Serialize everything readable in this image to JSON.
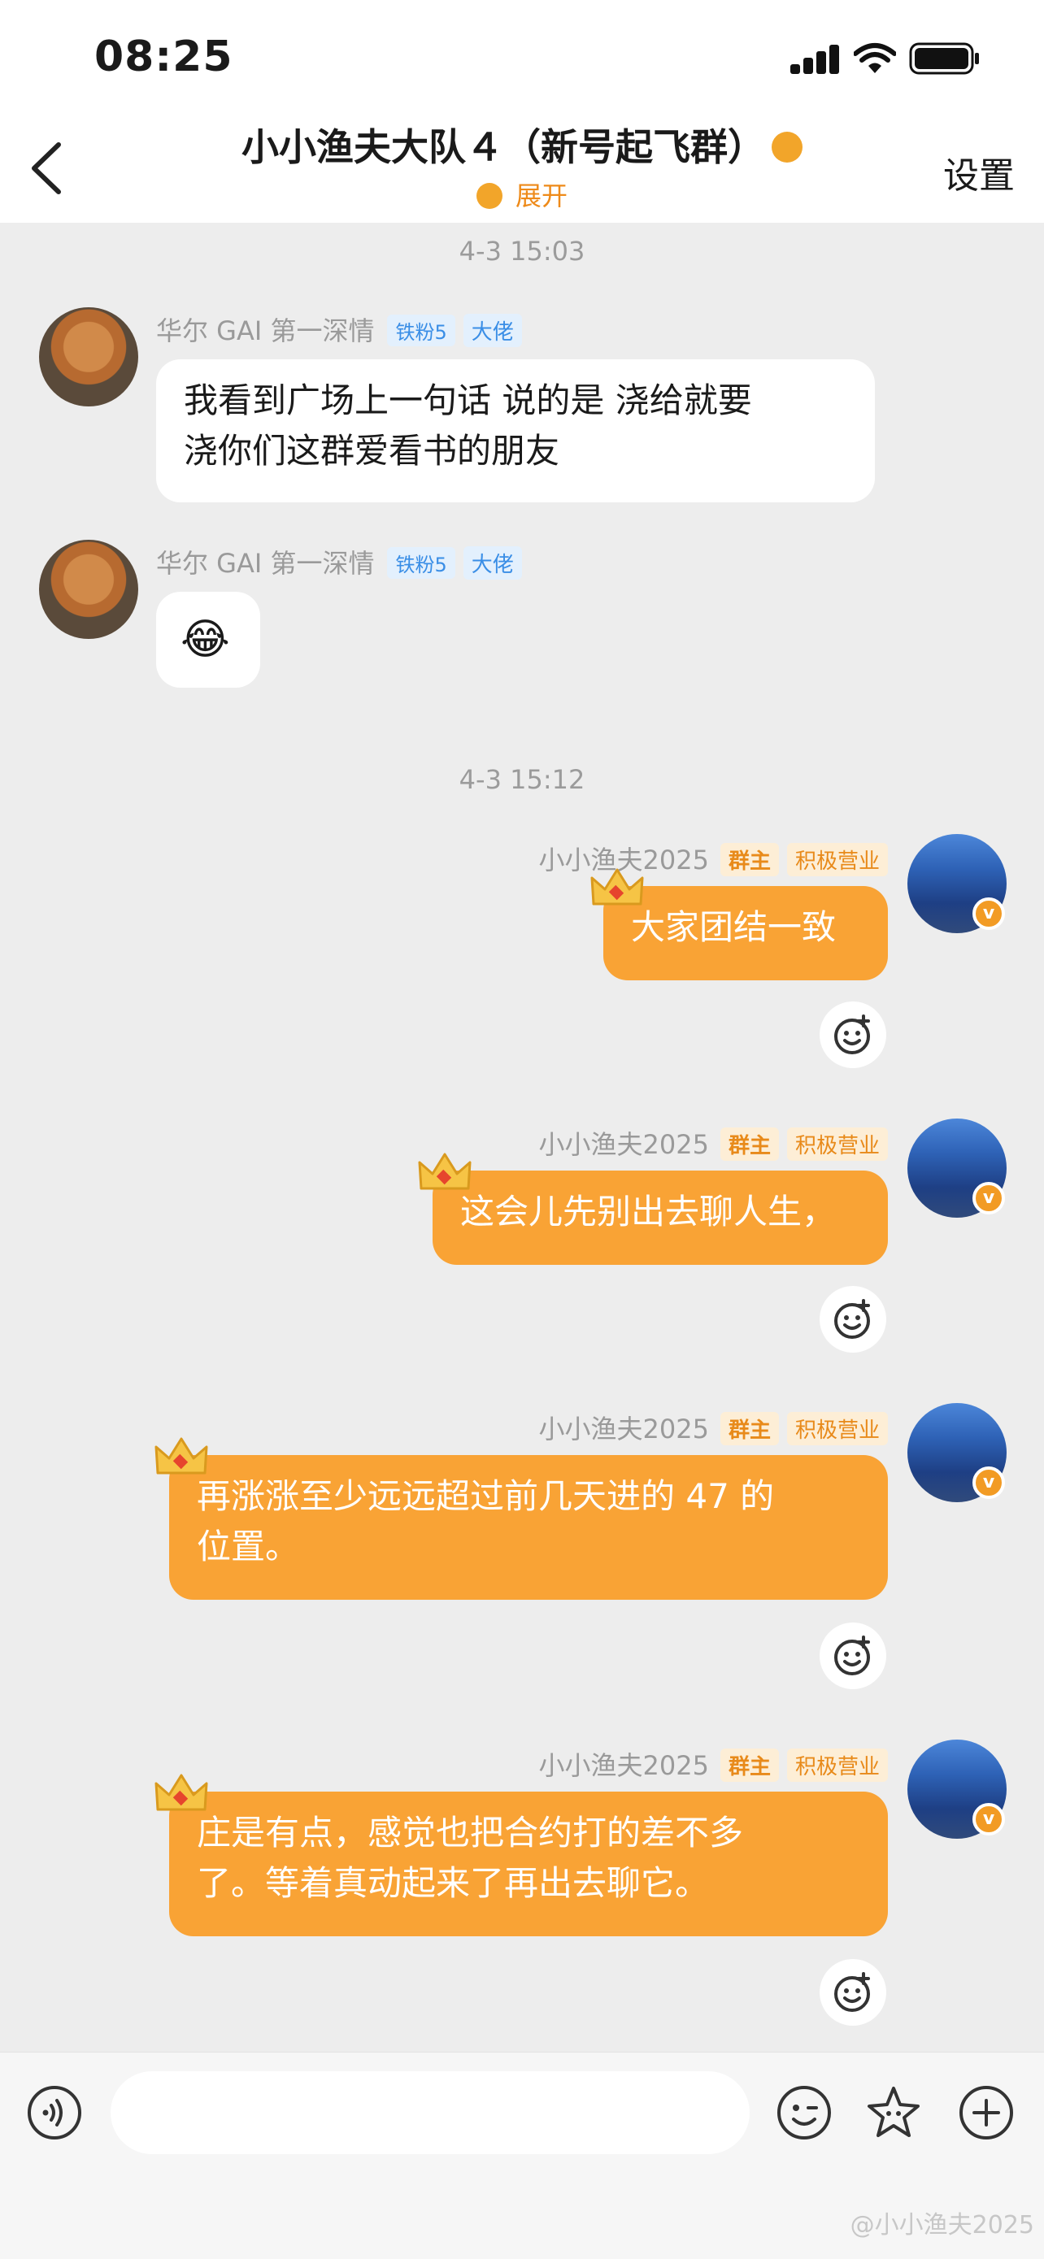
{
  "status_bar": {
    "time": "08:25"
  },
  "header": {
    "title": "小小渔夫大队４（新号起飞群）",
    "expand_label": "展开",
    "settings_label": "设置"
  },
  "timestamps": [
    "4-3 15:03",
    "4-3 15:12"
  ],
  "sender_left": {
    "name": "华尔 GAI 第一深情",
    "fan_badge": "铁粉5",
    "role_badge": "大佬"
  },
  "sender_right": {
    "name": "小小渔夫2025",
    "owner_badge": "群主",
    "active_badge": "积极营业",
    "avatar_badge": "v"
  },
  "messages": [
    {
      "line1": "我看到广场上一句话  说的是   浇给就要",
      "line2": "浇你们这群爱看书的朋友"
    },
    {
      "emoji": "😂"
    },
    {
      "text": "大家团结一致"
    },
    {
      "text": "这会儿先别出去聊人生，"
    },
    {
      "line1": "再涨涨至少远远超过前几天进的 47 的",
      "line2": "位置。"
    },
    {
      "line1": "庄是有点，感觉也把合约打的差不多",
      "line2": "了。等着真动起来了再出去聊它。"
    }
  ],
  "icons": {
    "back": "chevron-left-icon",
    "voice": "voice-icon",
    "emoji": "emoji-icon",
    "sticker": "star-sticker-icon",
    "add": "plus-icon",
    "reaction": "add-reaction-icon",
    "crown": "crown-icon"
  },
  "colors": {
    "accent": "#f9a335",
    "badge_blue": "#3a8ee6"
  },
  "watermark": "@小小渔夫2025"
}
